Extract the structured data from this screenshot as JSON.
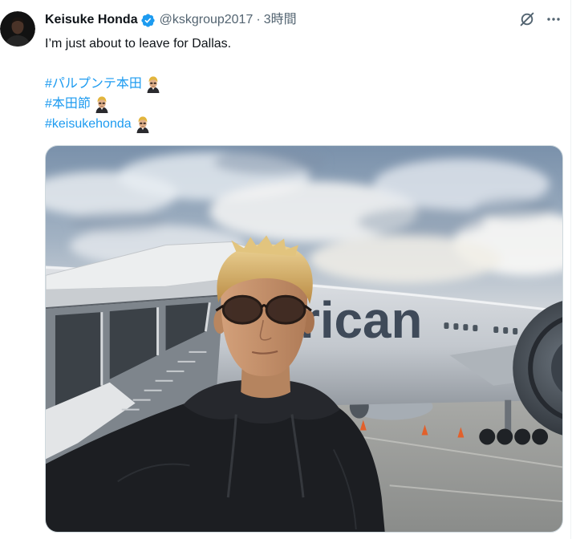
{
  "tweet": {
    "author": {
      "name": "Keisuke Honda",
      "handle": "@kskgroup2017",
      "verified": true
    },
    "separator": "·",
    "timestamp": "3時間",
    "text": "I’m just about to leave for Dallas.",
    "hashtags": [
      {
        "text": "#パルプンテ本田",
        "emoji": "honda-hashflag-icon"
      },
      {
        "text": "#本田節",
        "emoji": "honda-hashflag-icon"
      },
      {
        "text": "#keisukehonda",
        "emoji": "honda-hashflag-icon"
      }
    ]
  },
  "photo": {
    "plane_lettering": "rican"
  },
  "icons": {
    "verified": "verified-badge-icon",
    "grok": "grok-icon",
    "more": "more-icon"
  },
  "colors": {
    "text": "#0f1419",
    "secondary": "#536471",
    "link": "#1d9bf0",
    "verified": "#1d9bf0",
    "media_border": "#cfd9de"
  }
}
